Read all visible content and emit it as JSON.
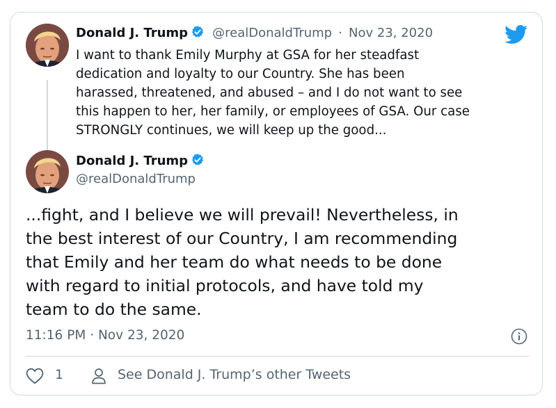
{
  "quoted_tweet": {
    "author_name": "Donald J. Trump",
    "author_handle": "@realDonaldTrump",
    "separator": "·",
    "date": "Nov 23, 2020",
    "text": "I want to thank Emily Murphy at GSA for her steadfast\ndedication and loyalty to our Country. She has been\nharassed, threatened, and abused – and I do not want to see\nthis happen to her, her family, or employees of GSA. Our case\nSTRONGLY continues, we will keep up the good..."
  },
  "main_tweet": {
    "author_name": "Donald J. Trump",
    "author_handle": "@realDonaldTrump",
    "text": "...fight, and I believe we will prevail! Nevertheless, in\nthe best interest of our Country, I am recommending\nthat Emily and her team do what needs to be done\nwith regard to initial protocols, and have told my\nteam to do the same.",
    "timestamp": "11:16 PM · Nov 23, 2020"
  },
  "footer": {
    "like_count": "1",
    "other_tweets_link": "See Donald J. Trump’s other Tweets"
  },
  "icons": {
    "brand": "twitter-bird-icon",
    "verified": "verified-badge-icon",
    "info": "info-icon",
    "like": "heart-icon",
    "profile": "person-icon"
  },
  "colors": {
    "twitter_blue": "#1d9bf0",
    "text_primary": "#0f1419",
    "text_secondary": "#536471",
    "border": "#cfd9de"
  }
}
